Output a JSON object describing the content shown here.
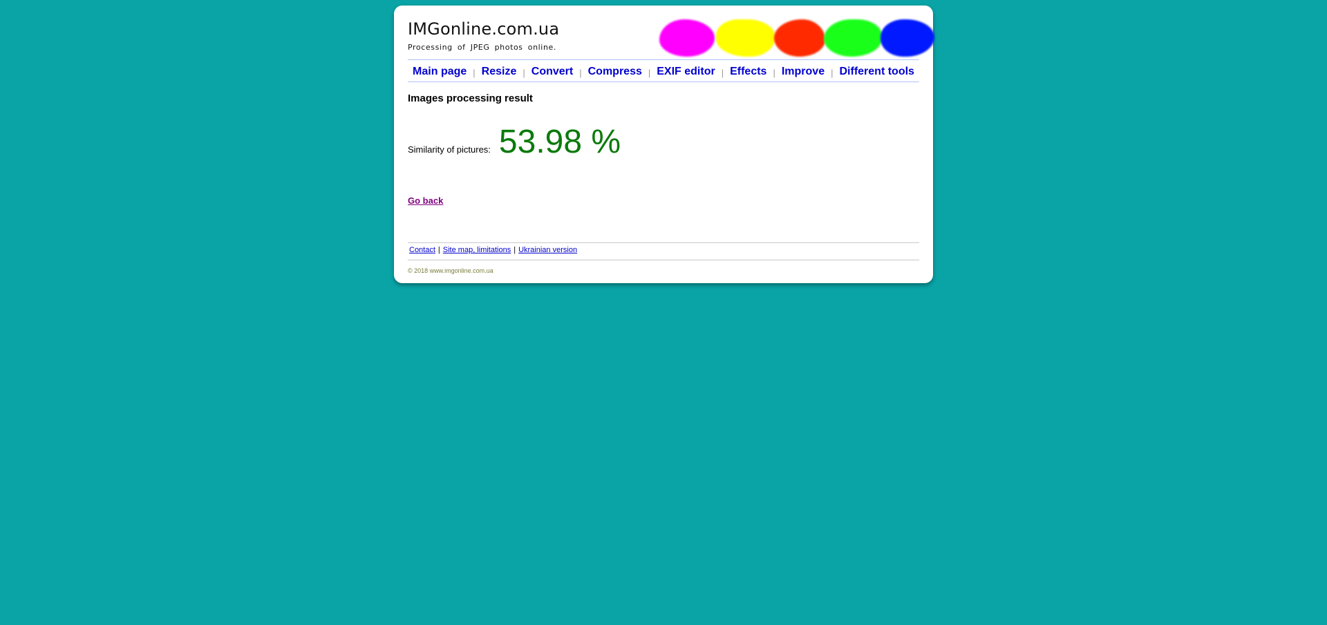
{
  "header": {
    "site_title": "IMGonline.com.ua",
    "tagline": "Processing of JPEG photos online."
  },
  "logo": {
    "icon": "color-blobs-logo",
    "colors": [
      "#ff00ff",
      "#ffff00",
      "#ff2a00",
      "#19ff19",
      "#0019ff"
    ]
  },
  "nav": {
    "items": [
      {
        "label": "Main page"
      },
      {
        "label": "Resize"
      },
      {
        "label": "Convert"
      },
      {
        "label": "Compress"
      },
      {
        "label": "EXIF editor"
      },
      {
        "label": "Effects"
      },
      {
        "label": "Improve"
      },
      {
        "label": "Different tools"
      }
    ],
    "separator": "|"
  },
  "main": {
    "heading": "Images processing result",
    "similarity_label": "Similarity of pictures:",
    "similarity_value": "53.98 %",
    "go_back": "Go back"
  },
  "footer": {
    "links": [
      {
        "label": "Contact"
      },
      {
        "label": "Site map, limitations"
      },
      {
        "label": "Ukrainian version"
      }
    ],
    "separator": "|",
    "copyright": "© 2018 www.imgonline.com.ua"
  },
  "colors": {
    "background": "#0aa3a6",
    "nav_link": "#0000cc",
    "similarity_value": "#0b7a0b",
    "visited_link": "#800080"
  }
}
